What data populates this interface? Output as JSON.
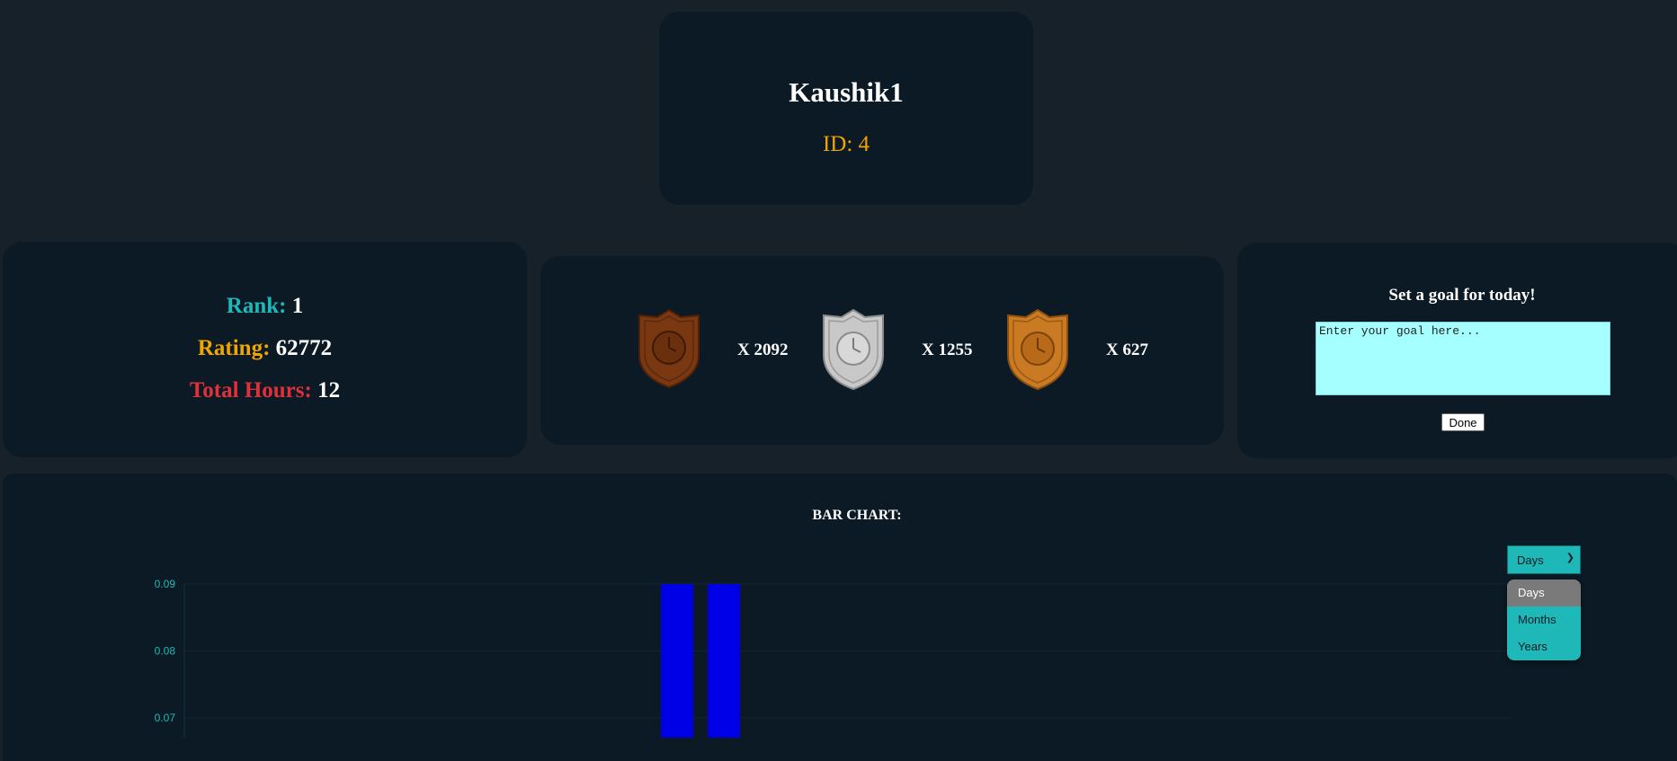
{
  "profile": {
    "username": "Kaushik1",
    "id_label": "ID: 4"
  },
  "stats": {
    "rank_label": "Rank:",
    "rank_value": "1",
    "rating_label": "Rating:",
    "rating_value": "62772",
    "hours_label": "Total Hours:",
    "hours_value": "12"
  },
  "badges": [
    {
      "icon": "bronze-clock-shield-icon",
      "color": "#7a3812",
      "count": "X 2092"
    },
    {
      "icon": "silver-clock-shield-icon",
      "color": "#c8c8c8",
      "count": "X 1255"
    },
    {
      "icon": "gold-clock-shield-icon",
      "color": "#c97a22",
      "count": "X 627"
    }
  ],
  "goal": {
    "title": "Set a goal for today!",
    "placeholder": "Enter your goal here...",
    "done_label": "Done"
  },
  "chart": {
    "title": "BAR CHART:",
    "period_select": {
      "selected": "Days",
      "options": [
        "Days",
        "Months",
        "Years"
      ]
    }
  },
  "colors": {
    "accent": "#1fb8b8",
    "bar": "#0000e6",
    "card": "#0b1a24",
    "page": "#16212a"
  },
  "chart_data": {
    "type": "bar",
    "title": "BAR CHART:",
    "y_ticks": [
      "0.09",
      "0.08",
      "0.07"
    ],
    "ylim_visible": [
      0.067,
      0.09
    ],
    "values": [
      0.09,
      0.09
    ],
    "xlabel": "",
    "ylabel": ""
  }
}
